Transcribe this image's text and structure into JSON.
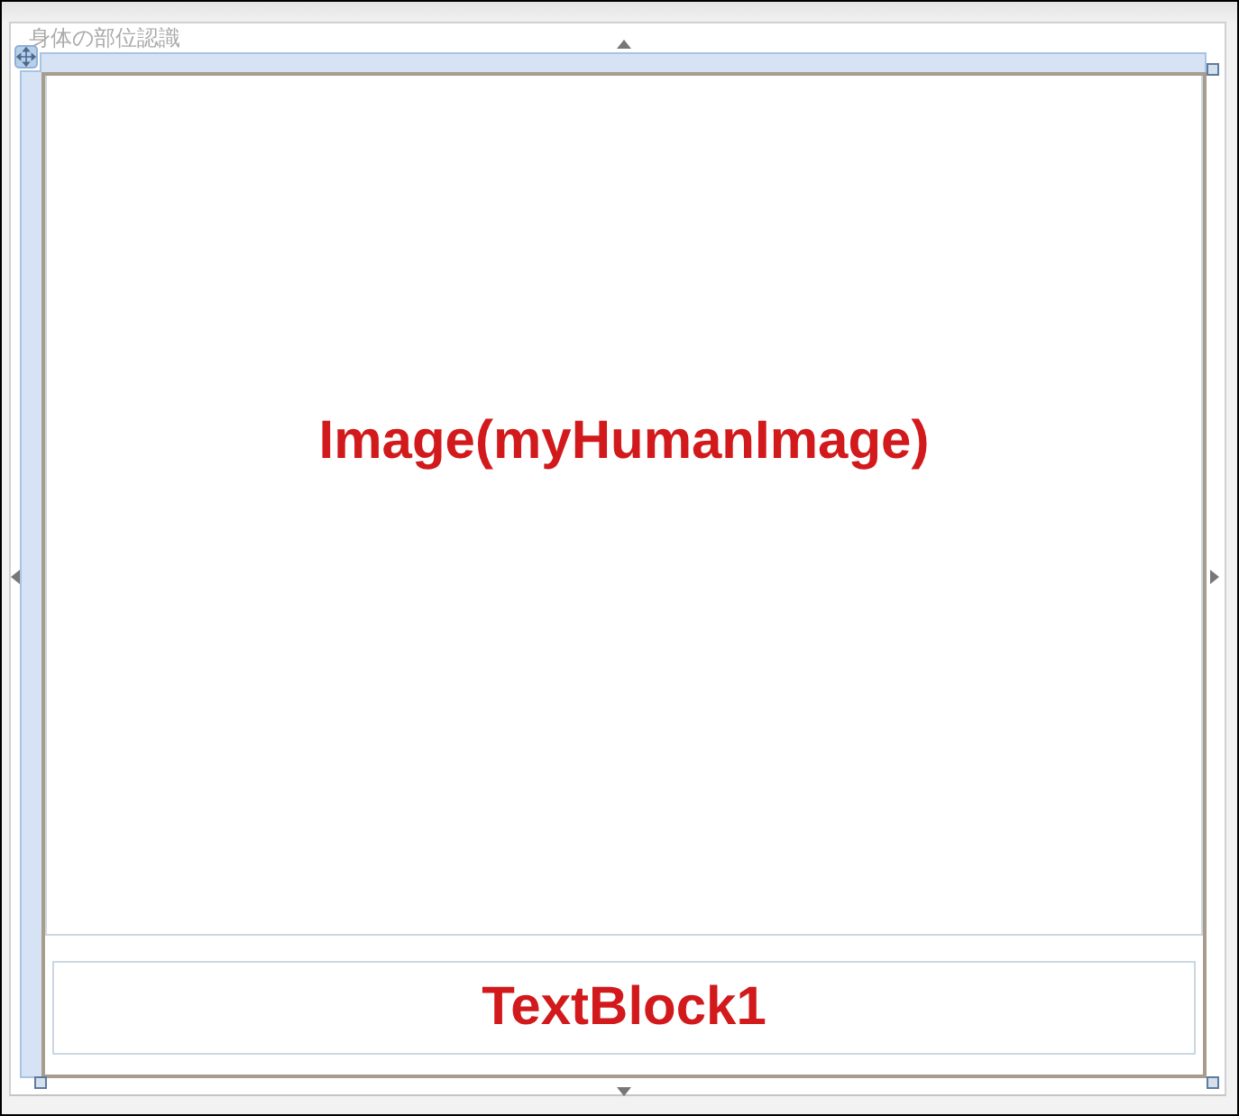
{
  "window_title": "身体の部位認識",
  "image_element": {
    "label": "Image(myHumanImage)"
  },
  "text_block": {
    "label": "TextBlock1"
  }
}
